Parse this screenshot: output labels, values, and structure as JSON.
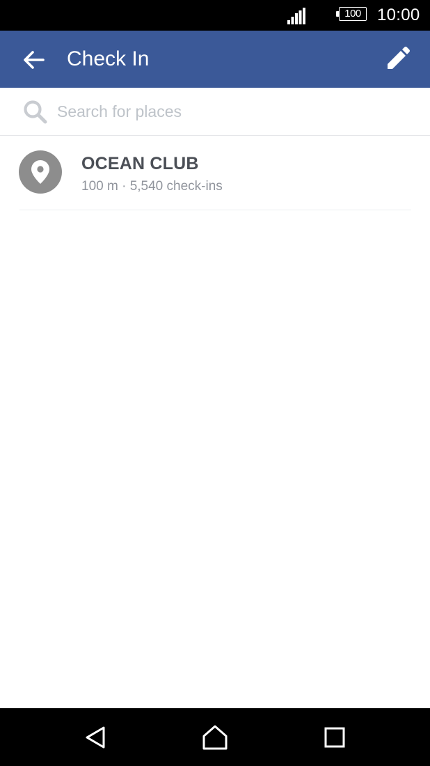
{
  "status_bar": {
    "battery_level": "100",
    "time": "10:00",
    "icons": [
      "signal-icon",
      "battery-icon"
    ]
  },
  "toolbar": {
    "title": "Check In",
    "back_icon": "arrow-left-icon",
    "edit_icon": "pencil-icon",
    "background_color": "#3b5998"
  },
  "search": {
    "placeholder": "Search for places",
    "value": "",
    "icon": "search-icon"
  },
  "places": [
    {
      "name": "OCEAN CLUB",
      "meta": "100 m · 5,540 check-ins",
      "icon": "map-pin-icon"
    }
  ],
  "nav_bar": {
    "icons": [
      "nav-back-icon",
      "nav-home-icon",
      "nav-recents-icon"
    ]
  }
}
